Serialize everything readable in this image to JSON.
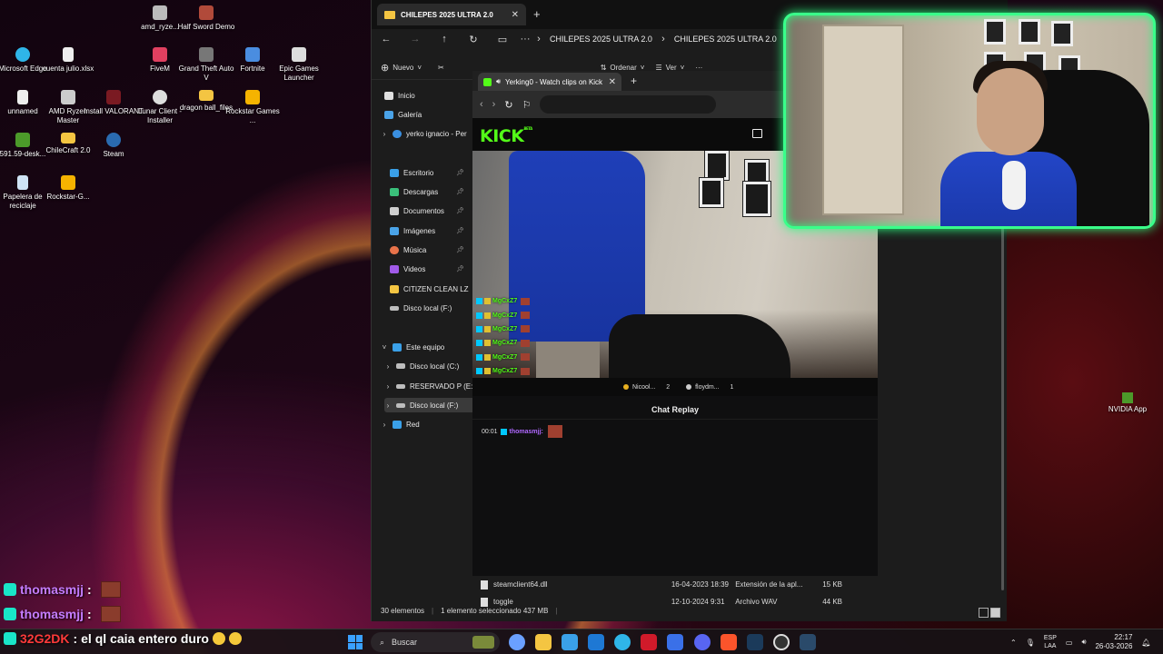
{
  "desktop": {
    "icons": [
      {
        "label": "amd_ryze...",
        "color": "#bbbbbb"
      },
      {
        "label": "Half Sword Demo",
        "color": "#b14a3a"
      },
      {
        "label": "Microsoft Edge",
        "color": "#2fb5e8"
      },
      {
        "label": "cuenta julio.xlsx",
        "color": "#eeeeee"
      },
      {
        "label": "FiveM",
        "color": "#e04060"
      },
      {
        "label": "Grand Theft Auto V",
        "color": "#777777"
      },
      {
        "label": "Fortnite",
        "color": "#4a8de0"
      },
      {
        "label": "Epic Games Launcher",
        "color": "#dddddd"
      },
      {
        "label": "unnamed",
        "color": "#eeeeee"
      },
      {
        "label": "AMD Ryzen Master",
        "color": "#cccccc"
      },
      {
        "label": "Install VALORANT",
        "color": "#7a1a22"
      },
      {
        "label": "Lunar Client - Installer",
        "color": "#dddddd"
      },
      {
        "label": "dragon ball_files",
        "color": "#f4c542"
      },
      {
        "label": "Rockstar Games ...",
        "color": "#f5b300"
      },
      {
        "label": "591.59-desk...",
        "color": "#4c9a2a"
      },
      {
        "label": "ChileCraft 2.0",
        "color": "#f4c542"
      },
      {
        "label": "Steam",
        "color": "#2a6bb0"
      },
      {
        "label": "Papelera de reciclaje",
        "color": "#cfe3f5"
      },
      {
        "label": "Rockstar-G...",
        "color": "#f5b300"
      }
    ],
    "nvidia_label": "NVIDIA App"
  },
  "explorer": {
    "tab_title": "CHILEPES 2025 ULTRA 2.0",
    "breadcrumb": [
      "CHILEPES 2025 ULTRA 2.0",
      "CHILEPES 2025 ULTRA 2.0"
    ],
    "toolbar": {
      "new_label": "Nuevo",
      "sort_label": "Ordenar",
      "view_label": "Ver"
    },
    "sidebar": [
      {
        "label": "Inicio",
        "color": "#e0e0e0"
      },
      {
        "label": "Galería",
        "color": "#4aa3e8"
      },
      {
        "label": "yerko ignacio - Per",
        "color": "#3a8fe0"
      },
      {
        "label": "Escritorio",
        "color": "#3aa0e8"
      },
      {
        "label": "Descargas",
        "color": "#3ac07a"
      },
      {
        "label": "Documentos",
        "color": "#cfcfcf"
      },
      {
        "label": "Imágenes",
        "color": "#4aa3e8"
      },
      {
        "label": "Música",
        "color": "#e8734a"
      },
      {
        "label": "Videos",
        "color": "#a05ae8"
      },
      {
        "label": "CITIZEN CLEAN LZ",
        "color": "#f4c542"
      },
      {
        "label": "Disco local (F:)",
        "color": "#bdbdbd"
      },
      {
        "label": "Este equipo",
        "color": "#3aa0e8"
      },
      {
        "label": "Disco local (C:)",
        "color": "#bdbdbd"
      },
      {
        "label": "RESERVADO P (E:)",
        "color": "#bdbdbd"
      },
      {
        "label": "Disco local (F:)",
        "color": "#bdbdbd"
      },
      {
        "label": "Red",
        "color": "#3aa0e8"
      }
    ],
    "files": [
      {
        "name": "steamclient64.dll",
        "date": "16-04-2023 18:39",
        "type": "Extensión de la apl...",
        "size": "15 KB"
      },
      {
        "name": "toggle",
        "date": "12-10-2024 9:31",
        "type": "Archivo WAV",
        "size": "44 KB"
      }
    ],
    "status": {
      "count": "30 elementos",
      "selected": "1 elemento seleccionado  437 MB"
    }
  },
  "browser": {
    "tab_title": "Yerking0 - Watch clips on Kick",
    "logo_text": "KICK",
    "logo_beta": "BETA",
    "video_chat": [
      "MgCxZ7",
      "MgCxZ7",
      "MgCxZ7",
      "MgCxZ7",
      "MgCxZ7",
      "MgCxZ7"
    ],
    "viewers": [
      {
        "name": "Nicool...",
        "count": "2"
      },
      {
        "name": "floydm...",
        "count": "1"
      }
    ],
    "chat_title": "Chat Replay",
    "chat_line": {
      "time": "00:01",
      "user": "thomasmjj:"
    }
  },
  "stream_chat": [
    {
      "user": "thomasmjj",
      "sep": ":",
      "message": ""
    },
    {
      "user": "thomasmjj",
      "sep": ":",
      "message": ""
    },
    {
      "user": "32G2DK",
      "sep": ":",
      "message": "el ql caia entero duro"
    }
  ],
  "taskbar": {
    "search_placeholder": "Buscar",
    "apps": [
      {
        "name": "widgets",
        "color": "#7a8a3a"
      },
      {
        "name": "copilot",
        "color": "#6aa0ff"
      },
      {
        "name": "file-explorer",
        "color": "#f4c542"
      },
      {
        "name": "store",
        "color": "#3aa0e8"
      },
      {
        "name": "outlook",
        "color": "#1e78d4"
      },
      {
        "name": "edge",
        "color": "#2fb5e8"
      },
      {
        "name": "adobe",
        "color": "#d01a2a"
      },
      {
        "name": "todo",
        "color": "#3a70e8"
      },
      {
        "name": "discord",
        "color": "#5865f2"
      },
      {
        "name": "brave",
        "color": "#fb542b"
      },
      {
        "name": "steam",
        "color": "#1b3a5a"
      },
      {
        "name": "obs",
        "color": "#333333"
      },
      {
        "name": "monitor",
        "color": "#2a4a6a"
      }
    ],
    "lang": "ESP",
    "region": "LAA",
    "time": "22:17",
    "date": "26-03-2026"
  }
}
